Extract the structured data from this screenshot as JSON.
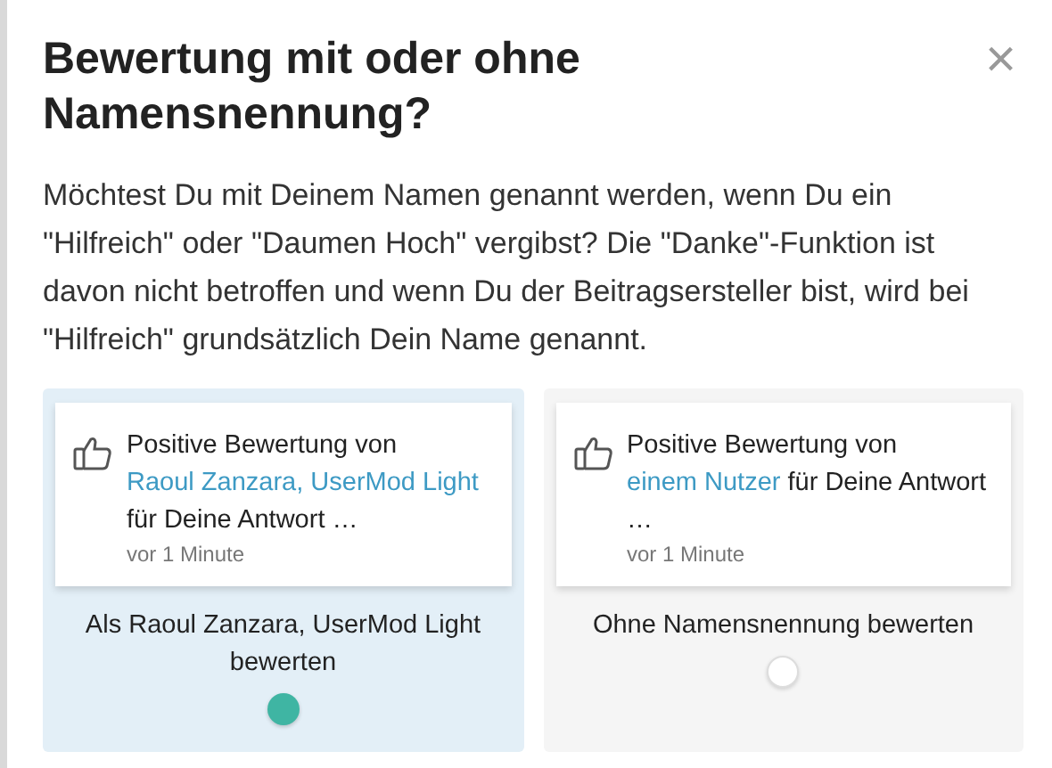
{
  "dialog": {
    "title": "Bewertung mit oder ohne Namensnennung?",
    "close": "×",
    "text": "Möchtest Du mit Deinem Namen genannt werden, wenn Du ein \"Hilfreich\" oder \"Daumen Hoch\" vergibst? Die \"Danke\"-Funktion ist davon nicht betroffen und wenn Du der Beitragsersteller bist, wird bei \"Hilfreich\" grundsätzlich Dein Name genannt."
  },
  "options": [
    {
      "selected": true,
      "notification": {
        "prefix": "Positive Bewertung von",
        "name": "Raoul Zanzara, UserMod Light",
        "suffix": "für Deine Antwort …",
        "time": "vor 1 Minute"
      },
      "label": "Als Raoul Zanzara, UserMod Light bewerten"
    },
    {
      "selected": false,
      "notification": {
        "prefix": "Positive Bewertung von",
        "name": "einem Nutzer",
        "suffix": "für Deine Antwort …",
        "time": "vor 1 Minute"
      },
      "label": "Ohne Namensnennung bewerten"
    }
  ]
}
